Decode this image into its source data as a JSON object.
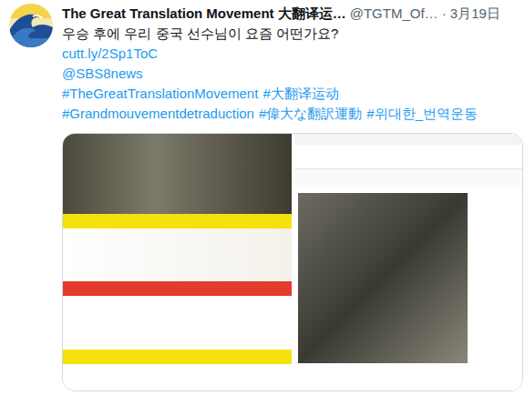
{
  "tweet": {
    "author": {
      "name": "The Great Translation Movement 大翻译运…",
      "handle": "@TGTM_Of…",
      "date": "· 3月19日"
    },
    "text": "우승 후에 우리 중국 선수님이 요즘 어떤가요?",
    "link": "cutt.ly/2Sp1ToC",
    "mention": "@SBS8news",
    "hashtag_lines": [
      [
        "#TheGreatTranslationMovement",
        "#大翻译运动"
      ],
      [
        "#Grandmouvementdetraduction",
        "#偉大な翻訳運動",
        "#위대한_번역운동"
      ]
    ],
    "media": [
      {
        "kind": "collage"
      },
      {
        "kind": "article"
      }
    ]
  }
}
